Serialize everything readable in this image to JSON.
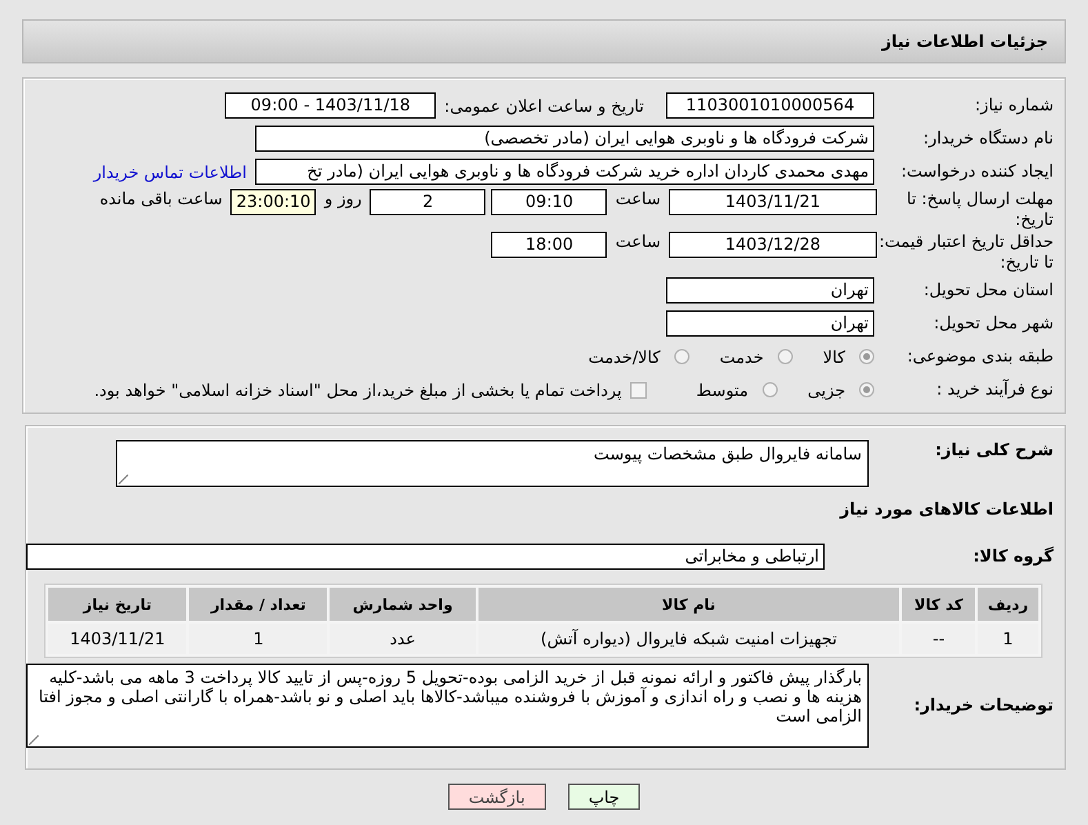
{
  "header": {
    "title": "جزئیات اطلاعات نیاز"
  },
  "need_number": {
    "label": "شماره نیاز:",
    "value": "1103001010000564"
  },
  "announce": {
    "label": "تاریخ و ساعت اعلان عمومی:",
    "value": "1403/11/18 - 09:00"
  },
  "buyer": {
    "label": "نام دستگاه خریدار:",
    "value": "شرکت فرودگاه ها و ناوبری هوایی ایران (مادر تخصصی)"
  },
  "creator": {
    "label": "ایجاد کننده درخواست:",
    "value": "مهدی محمدی کاردان اداره خرید شرکت فرودگاه ها و ناوبری هوایی ایران (مادر تخ",
    "link": "اطلاعات تماس خریدار"
  },
  "deadline": {
    "label": "مهلت ارسال پاسخ: تا تاریخ:",
    "date": "1403/11/21",
    "time_label": "ساعت",
    "time": "09:10",
    "days": "2",
    "days_label": "روز و",
    "remaining": "23:00:10",
    "remaining_label": "ساعت باقی مانده"
  },
  "validity": {
    "label": "حداقل تاریخ اعتبار قیمت: تا تاریخ:",
    "date": "1403/12/28",
    "time_label": "ساعت",
    "time": "18:00"
  },
  "province": {
    "label": "استان محل تحویل:",
    "value": "تهران"
  },
  "city": {
    "label": "شهر محل تحویل:",
    "value": "تهران"
  },
  "category": {
    "label": "طبقه بندی موضوعی:",
    "options": [
      {
        "label": "کالا",
        "selected": true
      },
      {
        "label": "خدمت",
        "selected": false
      },
      {
        "label": "کالا/خدمت",
        "selected": false
      }
    ]
  },
  "process": {
    "label": "نوع فرآیند خرید :",
    "options": [
      {
        "label": "جزیی",
        "selected": true
      },
      {
        "label": "متوسط",
        "selected": false
      }
    ],
    "payment": {
      "label": "پرداخت تمام یا بخشی از مبلغ خرید،از محل \"اسناد خزانه اسلامی\" خواهد بود.",
      "checked": false
    }
  },
  "description": {
    "label": "شرح کلی نیاز:",
    "value": "سامانه فایروال طبق مشخصات پیوست"
  },
  "goods_title": "اطلاعات کالاهای مورد نیاز",
  "goods_group": {
    "label": "گروه کالا:",
    "value": "ارتباطی و مخابراتی"
  },
  "table": {
    "columns": [
      "ردیف",
      "کد کالا",
      "نام کالا",
      "واحد شمارش",
      "تعداد / مقدار",
      "تاریخ نیاز"
    ],
    "rows": [
      [
        "1",
        "--",
        "تجهیزات امنیت شبکه فایروال (دیواره آتش)",
        "عدد",
        "1",
        "1403/11/21"
      ]
    ]
  },
  "buyer_notes": {
    "label": "توضیحات خریدار:",
    "value": "بارگذار پیش فاکتور و ارائه نمونه قبل از خرید الزامی بوده-تحویل 5 روزه-پس از تایید کالا پرداخت 3 ماهه می باشد-کلیه هزینه ها و نصب و راه اندازی و آموزش با فروشنده میباشد-کالاها باید اصلی و نو باشد-همراه با گارانتی اصلی و مجوز افتا الزامی است"
  },
  "buttons": [
    {
      "label": "چاپ",
      "kind": "print"
    },
    {
      "label": "بازگشت",
      "kind": "back"
    }
  ]
}
